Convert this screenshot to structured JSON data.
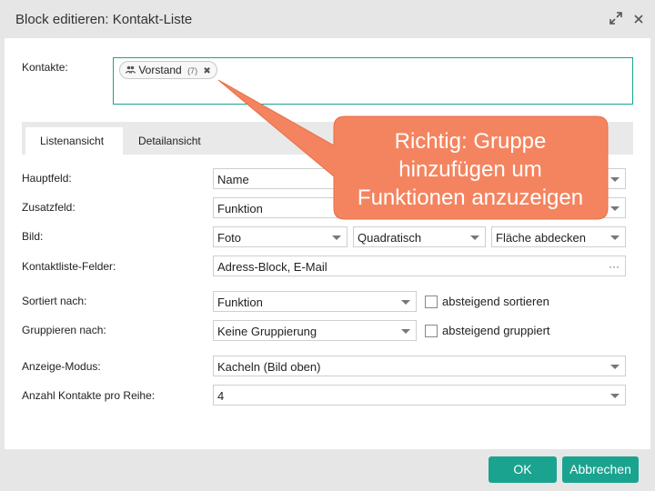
{
  "window": {
    "title": "Block editieren: Kontakt-Liste",
    "icons": [
      "expand-icon",
      "close-icon"
    ]
  },
  "contacts": {
    "label": "Kontakte:",
    "chip": {
      "icon": "group-icon",
      "name": "Vorstand",
      "count": "(7)",
      "remove": "✖"
    }
  },
  "tabs": [
    {
      "label": "Listenansicht",
      "active": true
    },
    {
      "label": "Detailansicht",
      "active": false
    }
  ],
  "fields": {
    "hauptfeld": {
      "label": "Hauptfeld:",
      "value": "Name"
    },
    "zusatzfeld": {
      "label": "Zusatzfeld:",
      "value": "Funktion"
    },
    "bild": {
      "label": "Bild:",
      "value1": "Foto",
      "value2": "Quadratisch",
      "value3": "Fläche abdecken"
    },
    "kontaktliste": {
      "label": "Kontaktliste-Felder:",
      "value": "Adress-Block, E-Mail",
      "more": "···"
    },
    "sortiert": {
      "label": "Sortiert nach:",
      "value": "Funktion",
      "checkbox_label": "absteigend sortieren",
      "checked": false
    },
    "gruppieren": {
      "label": "Gruppieren nach:",
      "value": "Keine Gruppierung",
      "checkbox_label": "absteigend gruppiert",
      "checked": false
    },
    "anzeige": {
      "label": "Anzeige-Modus:",
      "value": "Kacheln (Bild oben)"
    },
    "anzahl": {
      "label": "Anzahl Kontakte pro Reihe:",
      "value": "4"
    }
  },
  "callout": {
    "text": "Richtig: Gruppe hinzufügen um Funktionen anzuzeigen",
    "line1": "Richtig: Gruppe",
    "line2": "hinzufügen um",
    "line3": "Funktionen anzuzeigen",
    "color": "#f4845f"
  },
  "buttons": {
    "ok": "OK",
    "cancel": "Abbrechen"
  },
  "colors": {
    "accent": "#1aa38f",
    "callout": "#f4845f"
  }
}
